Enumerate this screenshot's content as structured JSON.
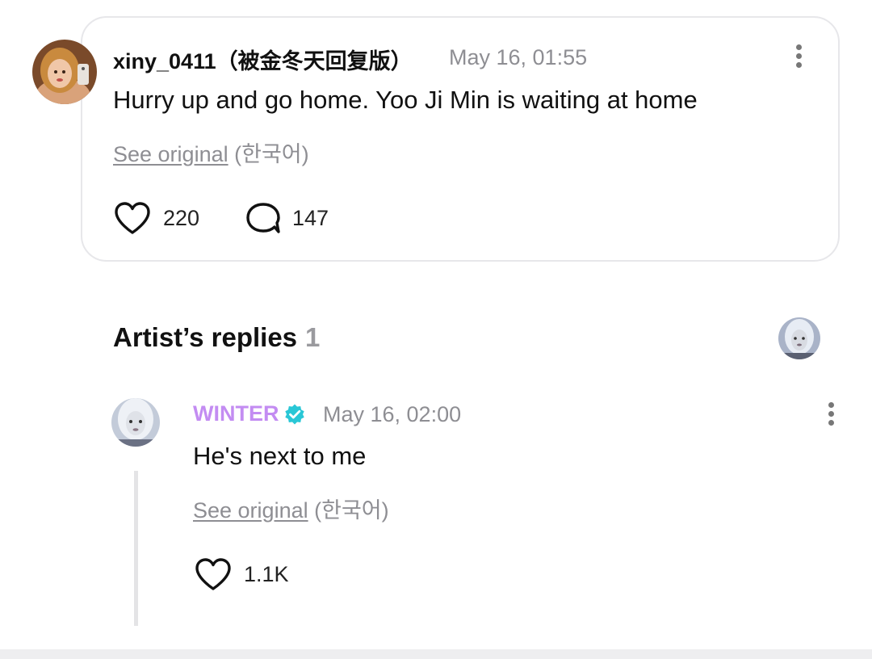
{
  "comment": {
    "username": "xiny_0411（被金冬天回复版）",
    "timestamp": "May 16, 01:55",
    "text": "Hurry up and go home. Yoo Ji Min is waiting at home",
    "see_original_link": "See original",
    "see_original_lang": "(한국어)",
    "likes": "220",
    "replies": "147",
    "icons": [
      "heart-icon",
      "comment-bubble-icon",
      "more-vertical-icon"
    ]
  },
  "artist_replies": {
    "title": "Artist’s replies",
    "count": "1",
    "items": [
      {
        "name": "WINTER",
        "name_color": "#c38cf2",
        "verified_color": "#29c7d6",
        "timestamp": "May 16, 02:00",
        "text": "He's next to me",
        "see_original_link": "See original",
        "see_original_lang": "(한국어)",
        "likes": "1.1K"
      }
    ]
  }
}
